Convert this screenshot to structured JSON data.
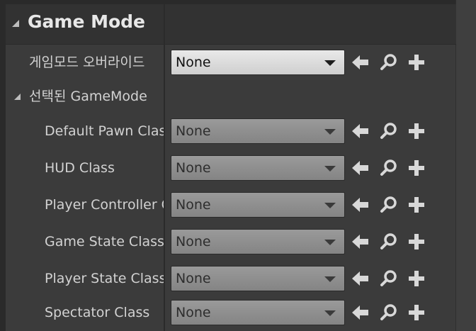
{
  "category": {
    "title": "Game Mode"
  },
  "override": {
    "label": "게임모드 오버라이드",
    "value": "None"
  },
  "selected_group": {
    "label": "선택된 GameMode"
  },
  "properties": [
    {
      "label": "Default Pawn Class",
      "value": "None"
    },
    {
      "label": "HUD Class",
      "value": "None"
    },
    {
      "label": "Player Controller Class",
      "value": "None"
    },
    {
      "label": "Game State Class",
      "value": "None"
    },
    {
      "label": "Player State Class",
      "value": "None"
    },
    {
      "label": "Spectator Class",
      "value": "None"
    }
  ],
  "icons": {
    "use": "arrow-left-icon",
    "browse": "search-icon",
    "add": "plus-icon"
  },
  "colors": {
    "panel": "#3b3b3b",
    "header": "#323232",
    "active_combo": "#e0e0e0",
    "disabled_combo": "#8e8e8e",
    "icon": "#d8d8d8"
  }
}
